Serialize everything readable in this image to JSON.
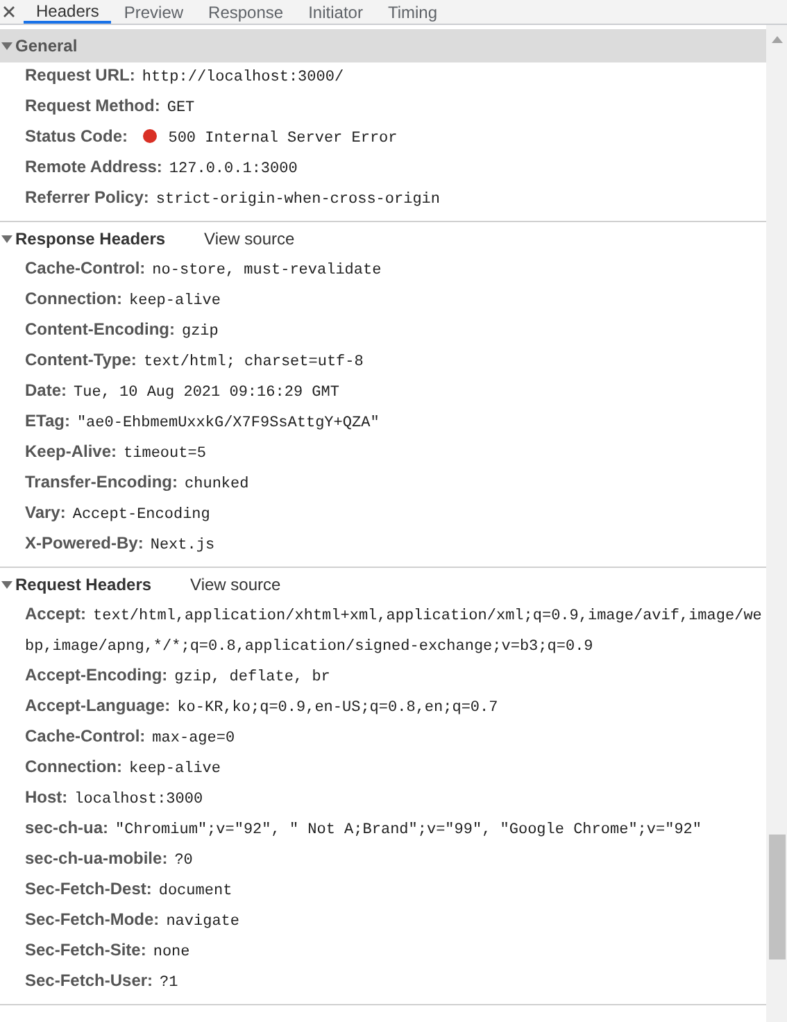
{
  "tabs": [
    {
      "label": "Headers",
      "selected": true
    },
    {
      "label": "Preview",
      "selected": false
    },
    {
      "label": "Response",
      "selected": false
    },
    {
      "label": "Initiator",
      "selected": false
    },
    {
      "label": "Timing",
      "selected": false
    }
  ],
  "sections": [
    {
      "title": "General",
      "expanded": true,
      "kind": "general",
      "rows": [
        {
          "name": "Request URL:",
          "value": "http://localhost:3000/"
        },
        {
          "name": "Request Method:",
          "value": "GET"
        },
        {
          "name": "Status Code:",
          "value": "500 Internal Server Error",
          "color": "#d93025"
        },
        {
          "name": "Remote Address:",
          "value": "127.0.0.1:3000"
        },
        {
          "name": "Referrer Policy:",
          "value": "strict-origin-when-cross-origin"
        }
      ]
    },
    {
      "title": "Response Headers",
      "expanded": true,
      "kind": "headers",
      "link": "View source",
      "rows": [
        {
          "name": "Cache-Control:",
          "value": "no-store, must-revalidate"
        },
        {
          "name": "Connection:",
          "value": "keep-alive"
        },
        {
          "name": "Content-Encoding:",
          "value": "gzip"
        },
        {
          "name": "Content-Type:",
          "value": "text/html; charset=utf-8"
        },
        {
          "name": "Date:",
          "value": "Tue, 10 Aug 2021 09:16:29 GMT"
        },
        {
          "name": "ETag:",
          "value": "\"ae0-EhbmemUxxkG/X7F9SsAttgY+QZA\""
        },
        {
          "name": "Keep-Alive:",
          "value": "timeout=5"
        },
        {
          "name": "Transfer-Encoding:",
          "value": "chunked"
        },
        {
          "name": "Vary:",
          "value": "Accept-Encoding"
        },
        {
          "name": "X-Powered-By:",
          "value": "Next.js"
        }
      ]
    },
    {
      "title": "Request Headers",
      "expanded": true,
      "kind": "headers",
      "link": "View source",
      "rows": [
        {
          "name": "Accept:",
          "value": "text/html,application/xhtml+xml,application/xml;q=0.9,image/avif,image/webp,image/apng,*/*;q=0.8,application/signed-exchange;v=b3;q=0.9"
        },
        {
          "name": "Accept-Encoding:",
          "value": "gzip, deflate, br"
        },
        {
          "name": "Accept-Language:",
          "value": "ko-KR,ko;q=0.9,en-US;q=0.8,en;q=0.7"
        },
        {
          "name": "Cache-Control:",
          "value": "max-age=0"
        },
        {
          "name": "Connection:",
          "value": "keep-alive"
        },
        {
          "name": "Host:",
          "value": "localhost:3000"
        },
        {
          "name": "sec-ch-ua:",
          "value": "\"Chromium\";v=\"92\", \" Not A;Brand\";v=\"99\", \"Google Chrome\";v=\"92\""
        },
        {
          "name": "sec-ch-ua-mobile:",
          "value": "?0"
        },
        {
          "name": "Sec-Fetch-Dest:",
          "value": "document"
        },
        {
          "name": "Sec-Fetch-Mode:",
          "value": "navigate"
        },
        {
          "name": "Sec-Fetch-Site:",
          "value": "none"
        },
        {
          "name": "Sec-Fetch-User:",
          "value": "?1"
        }
      ]
    }
  ]
}
